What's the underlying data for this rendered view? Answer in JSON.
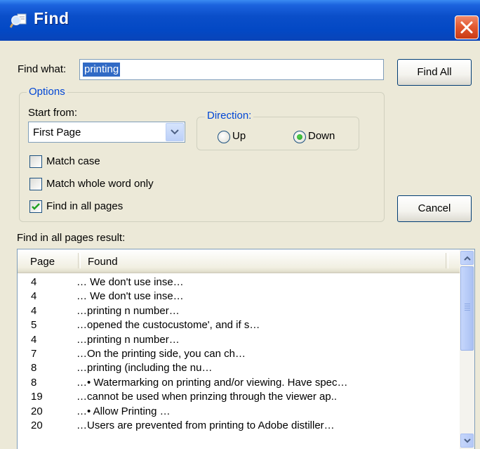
{
  "window": {
    "title": "Find"
  },
  "find": {
    "label": "Find what:",
    "value": "printing",
    "find_all_label": "Find All"
  },
  "options": {
    "title": "Options",
    "start_from_label": "Start from:",
    "start_from_value": "First Page",
    "direction": {
      "title": "Direction:",
      "up_label": "Up",
      "down_label": "Down",
      "selected": "Down"
    },
    "match_case": {
      "label": "Match case",
      "checked": false
    },
    "match_whole_word": {
      "label": "Match whole word only",
      "checked": false
    },
    "find_in_all_pages": {
      "label": "Find in all pages",
      "checked": true
    }
  },
  "cancel_label": "Cancel",
  "results": {
    "label": "Find in all pages result:",
    "columns": [
      "Page",
      "Found"
    ],
    "rows": [
      {
        "page": "4",
        "found": "… We don't use inse…"
      },
      {
        "page": "4",
        "found": "… We don't use inse…"
      },
      {
        "page": "4",
        "found": "…printing n number…"
      },
      {
        "page": "5",
        "found": "…opened the custocustome', and if s…"
      },
      {
        "page": "4",
        "found": "…printing n number…"
      },
      {
        "page": "7",
        "found": "…On the printing side, you can ch…"
      },
      {
        "page": "8",
        "found": "…printing (including the nu…"
      },
      {
        "page": "8",
        "found": "…• Watermarking on printing and/or viewing.  Have spec…"
      },
      {
        "page": "19",
        "found": "…cannot be used when prinzing through the viewer ap.."
      },
      {
        "page": "20",
        "found": "…• Allow Printing …"
      },
      {
        "page": "20",
        "found": "…Users are prevented from printing to Adobe distiller…"
      }
    ]
  },
  "colors": {
    "title_bar": "#0a4ec9",
    "accent": "#316ac5",
    "group_title": "#0046d5",
    "close": "#e35a32"
  }
}
